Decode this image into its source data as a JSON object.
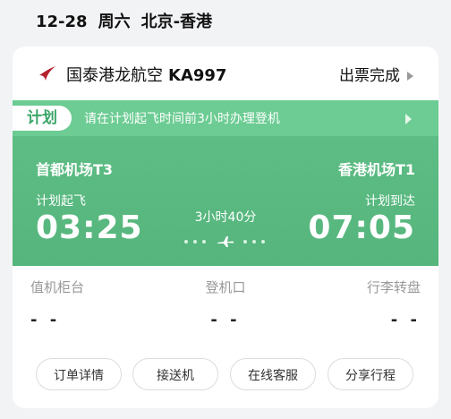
{
  "header": {
    "date": "12-28",
    "weekday": "周六",
    "route": "北京-香港"
  },
  "flight": {
    "airline": "国泰港龙航空",
    "flight_no": "KA997",
    "status": "出票完成",
    "plan_tag": "计划",
    "plan_notice": "请在计划起飞时间前3小时办理登机",
    "departure": {
      "airport": "首都机场T3",
      "label": "计划起飞",
      "time": "03:25"
    },
    "arrival": {
      "airport": "香港机场T1",
      "label": "计划到达",
      "time": "07:05"
    },
    "duration": "3小时40分"
  },
  "info": {
    "counter": {
      "label": "值机柜台",
      "value": "- -"
    },
    "gate": {
      "label": "登机口",
      "value": "- -"
    },
    "baggage": {
      "label": "行李转盘",
      "value": "- -"
    }
  },
  "actions": {
    "order_detail": "订单详情",
    "transfer": "接送机",
    "support": "在线客服",
    "share": "分享行程"
  },
  "colors": {
    "accent": "#5fbf86",
    "logo": "#b51f2e"
  },
  "icons": {
    "airline_logo": "airline-logo-icon",
    "plane": "plane-icon",
    "arrow": "chevron-right-icon"
  }
}
